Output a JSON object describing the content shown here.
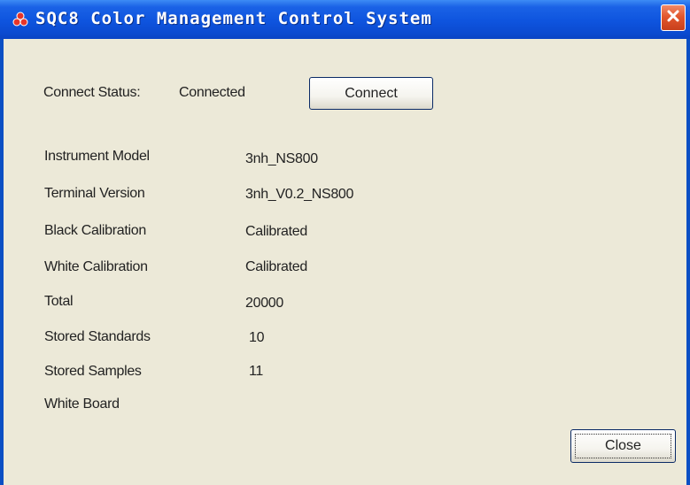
{
  "window": {
    "title": "SQC8 Color Management Control System",
    "title_bar_color": "#0e54de",
    "close_button_color": "#e2572e",
    "icons": {
      "app": "app-logo-icon",
      "close": "close-icon"
    }
  },
  "connection": {
    "status_label": "Connect Status:",
    "status_value": "Connected",
    "connect_button_label": "Connect"
  },
  "info": {
    "instrument_model": {
      "label": "Instrument Model",
      "value": "3nh_NS800"
    },
    "terminal_version": {
      "label": "Terminal Version",
      "value": "3nh_V0.2_NS800"
    },
    "black_calibration": {
      "label": "Black Calibration",
      "value": "Calibrated"
    },
    "white_calibration": {
      "label": "White Calibration",
      "value": "Calibrated"
    },
    "total": {
      "label": "Total",
      "value": "20000"
    },
    "stored_standards": {
      "label": "Stored Standards",
      "value": "10"
    },
    "stored_samples": {
      "label": "Stored Samples",
      "value": "11"
    },
    "white_board": {
      "label": "White Board",
      "value": ""
    }
  },
  "footer": {
    "close_button_label": "Close"
  }
}
